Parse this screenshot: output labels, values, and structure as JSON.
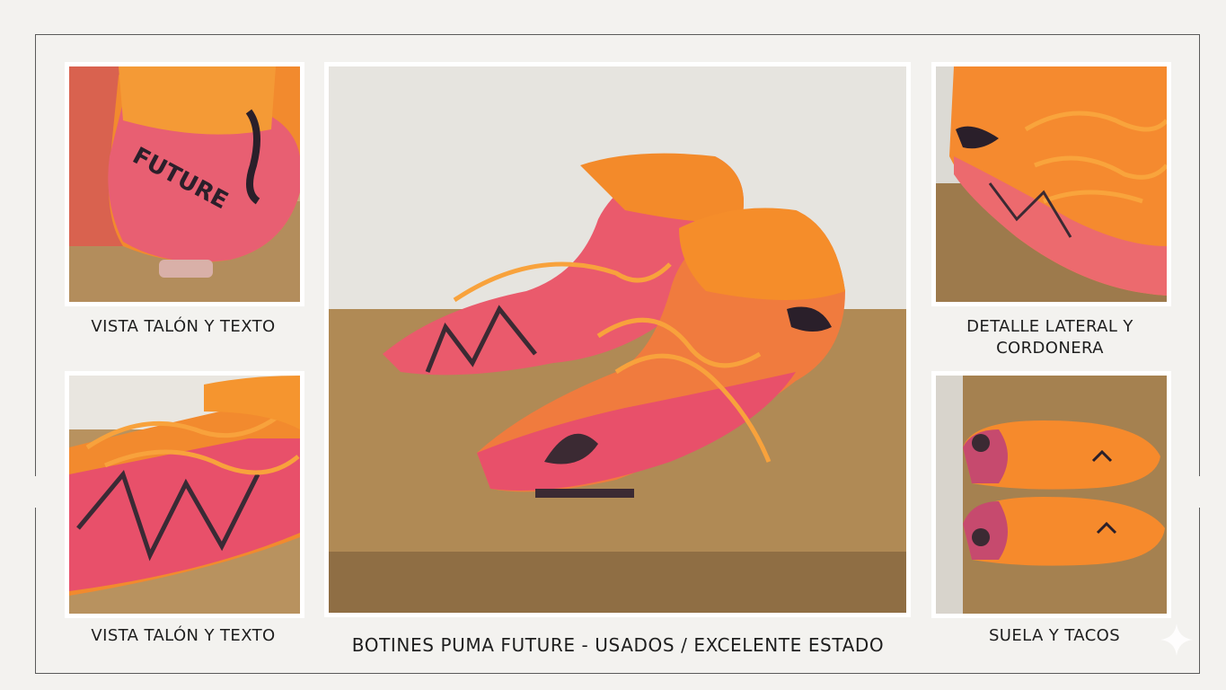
{
  "captions": {
    "top_left": "VISTA TALÓN Y TEXTO",
    "bottom_left": "VISTA TALÓN Y TEXTO",
    "top_right_line1": "DETALLE LATERAL Y",
    "top_right_line2": "CORDONERA",
    "bottom_right": "SUELA Y TACOS",
    "main": "BOTINES PUMA FUTURE - USADOS / EXCELENTE ESTADO"
  },
  "colors": {
    "background": "#f3f2ef",
    "boot_orange": "#f7892a",
    "boot_pink": "#e8506a",
    "wood": "#a8834f"
  },
  "photos": [
    {
      "id": "heel",
      "icon": "boot-heel-photo"
    },
    {
      "id": "side-front",
      "icon": "boot-side-photo"
    },
    {
      "id": "main",
      "icon": "boots-pair-photo"
    },
    {
      "id": "laces",
      "icon": "boot-laces-photo"
    },
    {
      "id": "soles",
      "icon": "boot-soles-photo"
    }
  ]
}
